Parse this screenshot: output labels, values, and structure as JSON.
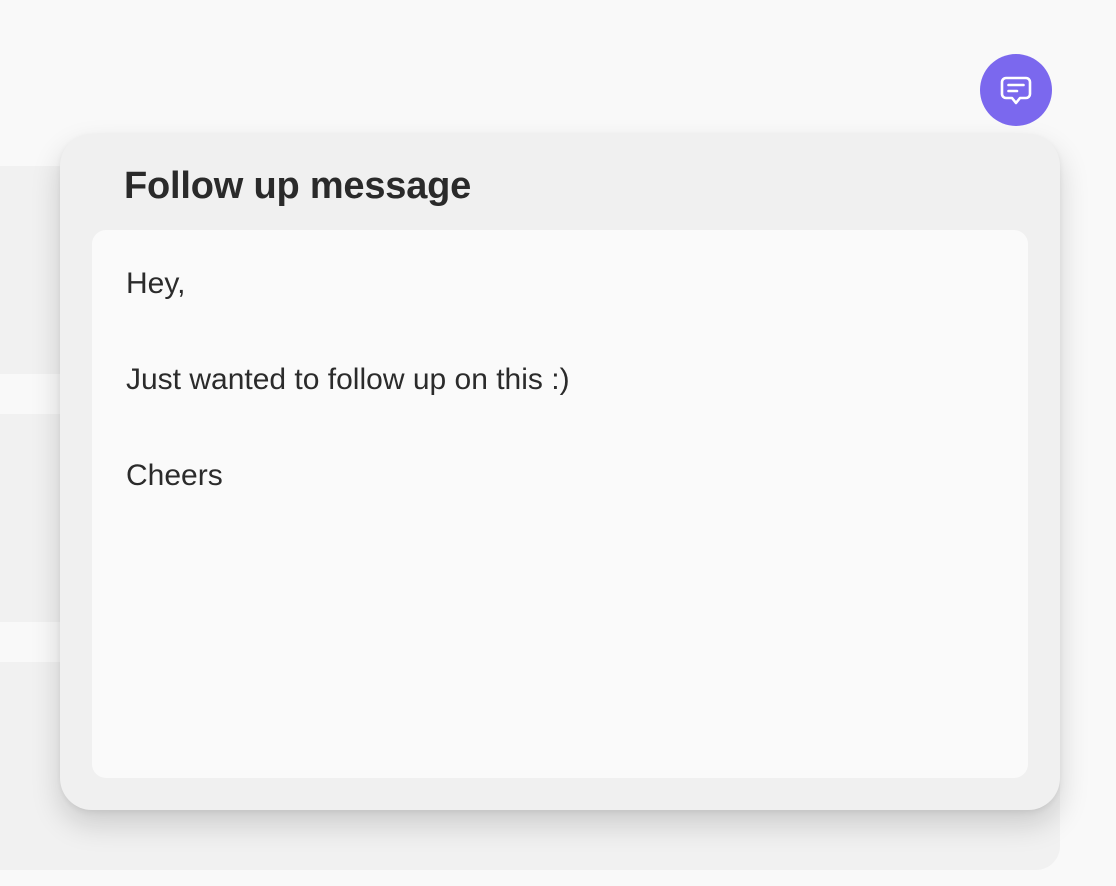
{
  "chat_button": {
    "icon": "chat-bubble-icon",
    "color": "#7b68ee"
  },
  "popover": {
    "title": "Follow up message",
    "message_lines": [
      "Hey,",
      "Just wanted to follow up on this :)",
      "Cheers"
    ]
  }
}
